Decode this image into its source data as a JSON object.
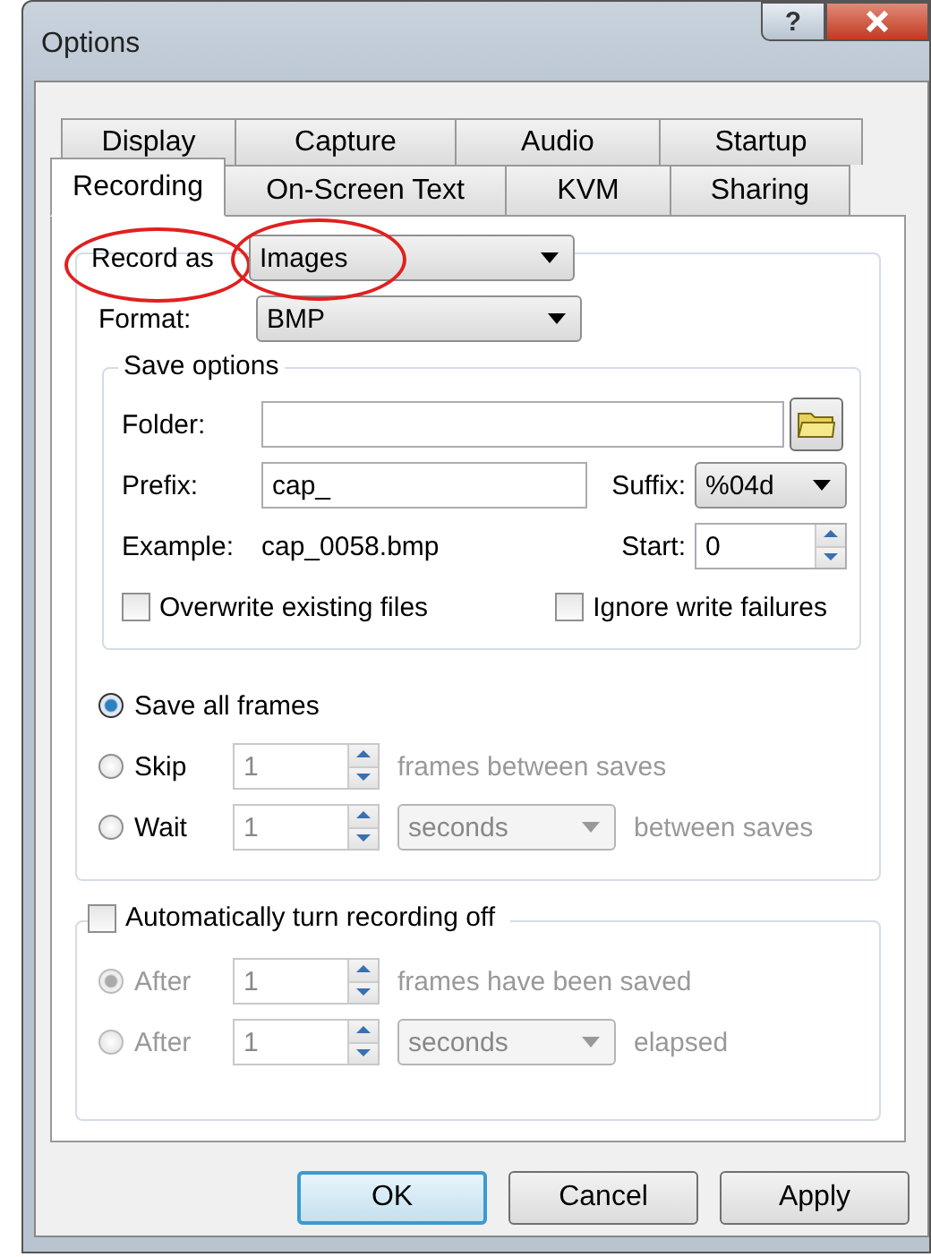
{
  "window": {
    "title": "Options",
    "help_button": "?"
  },
  "tabs": [
    [
      {
        "label": "Display",
        "selected": false
      },
      {
        "label": "Capture",
        "selected": false
      },
      {
        "label": "Audio",
        "selected": false
      },
      {
        "label": "Startup",
        "selected": false
      }
    ],
    [
      {
        "label": "Recording",
        "selected": true
      },
      {
        "label": "On-Screen Text",
        "selected": false
      },
      {
        "label": "KVM",
        "selected": false
      },
      {
        "label": "Sharing",
        "selected": false
      }
    ]
  ],
  "record_as": {
    "label": "Record as",
    "value": "Images",
    "label_highlighted": true,
    "value_highlighted": true
  },
  "format": {
    "label": "Format:",
    "value": "BMP"
  },
  "save_options": {
    "title": "Save options",
    "folder": {
      "label": "Folder:"
    },
    "prefix": {
      "label": "Prefix:",
      "value": "cap_"
    },
    "suffix": {
      "label": "Suffix:",
      "value": "%04d"
    },
    "example": {
      "label": "Example:",
      "value": "cap_0058.bmp"
    },
    "start": {
      "label": "Start:",
      "value": "0"
    },
    "checkboxes": [
      {
        "label": "Overwrite existing files",
        "checked": false
      },
      {
        "label": "Ignore write failures",
        "checked": false
      }
    ]
  },
  "frame_modes": [
    {
      "kind": "plain",
      "label": "Save all frames",
      "selected": true
    },
    {
      "kind": "count",
      "label": "Skip",
      "selected": false,
      "value": "1",
      "suffix": "frames between saves"
    },
    {
      "kind": "time",
      "label": "Wait",
      "selected": false,
      "value": "1",
      "unit": "seconds",
      "suffix": "between saves"
    }
  ],
  "auto_off": {
    "label": "Automatically turn recording off",
    "checked": false,
    "options": [
      {
        "kind": "count",
        "label": "After",
        "selected": true,
        "disabled": true,
        "value": "1",
        "suffix": "frames have been saved"
      },
      {
        "kind": "time",
        "label": "After",
        "selected": false,
        "disabled": true,
        "value": "1",
        "unit": "seconds",
        "suffix": "elapsed"
      }
    ]
  },
  "buttons": [
    {
      "label": "OK",
      "default": true
    },
    {
      "label": "Cancel",
      "default": false
    },
    {
      "label": "Apply",
      "default": false
    }
  ]
}
